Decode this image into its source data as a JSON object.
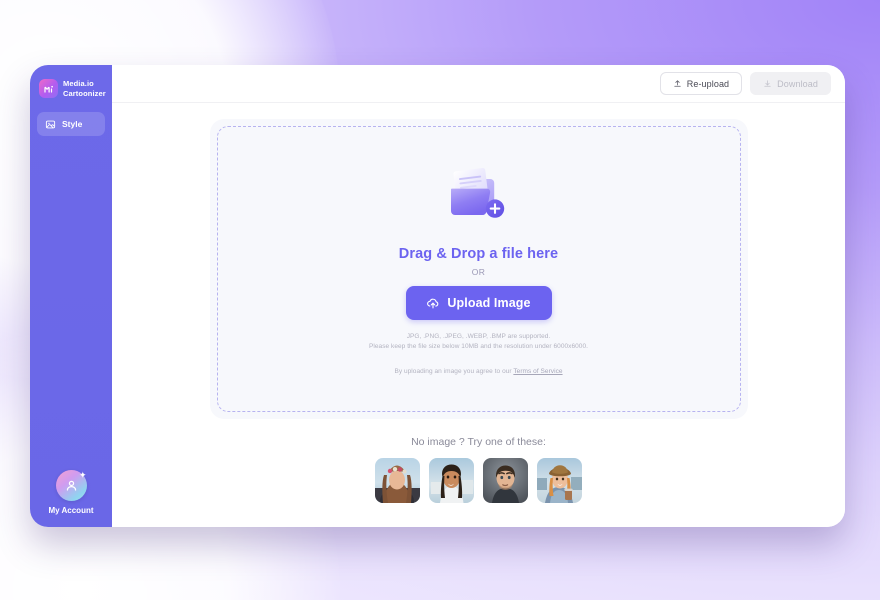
{
  "window": {
    "sidebar": {
      "brand": {
        "name": "Media.io\nCartoonizer",
        "icon": "media-io-logo-icon"
      },
      "items": [
        {
          "label": "Style",
          "icon": "image-style-icon",
          "active": true
        }
      ],
      "account": {
        "label": "My Account",
        "icon": "user-avatar-icon"
      }
    },
    "topbar": {
      "buttons": [
        {
          "id": "re-upload",
          "label": "Re-upload",
          "icon": "upload-arrow-icon",
          "disabled": false
        },
        {
          "id": "download",
          "label": "Download",
          "icon": "download-arrow-icon",
          "disabled": true
        }
      ]
    },
    "dropzone": {
      "icon": "folder-add-icon",
      "title": "Drag & Drop a file here",
      "or": "OR",
      "upload_button": {
        "label": "Upload Image",
        "icon": "cloud-upload-icon"
      },
      "hint_formats": "JPG, .PNG, .JPEG, .WEBP, .BMP are supported.",
      "hint_limits": "Please keep the file size below 10MB and the resolution under 6000x6000.",
      "terms_prefix": "By uploading an image you agree to our ",
      "terms_link": "Terms of Service"
    },
    "samples": {
      "title": "No image ? Try one of these:",
      "items": [
        {
          "name": "sample-woman-flower-crown",
          "alt": "Woman with flower crown at the beach"
        },
        {
          "name": "sample-woman-smiling",
          "alt": "Smiling woman outdoors"
        },
        {
          "name": "sample-man-portrait",
          "alt": "Man portrait on grey background"
        },
        {
          "name": "sample-woman-hat-coffee",
          "alt": "Woman in hat holding coffee"
        }
      ]
    }
  },
  "colors": {
    "sidebar": "#6c6ae8",
    "accent": "#6c63f0",
    "backdrop_top_right": "#a183f8",
    "backdrop_bottom_left": "#efe9fe",
    "card": "#f7f8fc",
    "dashed_border": "#b7b3f0",
    "muted_text": "#b3b3c0",
    "disabled_button": "#f0f0f3"
  }
}
